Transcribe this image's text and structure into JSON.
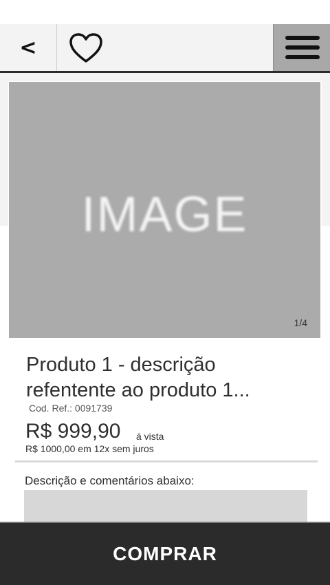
{
  "header": {
    "back_label": "<",
    "favorite_icon": "heart-icon",
    "menu_icon": "hamburger-menu-icon"
  },
  "product": {
    "image_placeholder": "IMAGE",
    "image_counter": "1/4",
    "title": "Produto 1 - descrição refentente ao produto 1...",
    "ref_code": "Cod. Ref.: 0091739",
    "price": "R$ 999,90",
    "price_suffix": "á vista",
    "installments": "R$ 1000,00 em 12x sem juros"
  },
  "description": {
    "label": "Descrição e comentários abaixo:"
  },
  "footer": {
    "buy_label": "COMPRAR"
  },
  "colors": {
    "header_bg": "#f3f3f3",
    "menu_button_bg": "#a8a8a8",
    "image_placeholder_bg": "#ababab",
    "buy_bar_bg": "#2b2b2b",
    "text": "#2f2f2f"
  }
}
